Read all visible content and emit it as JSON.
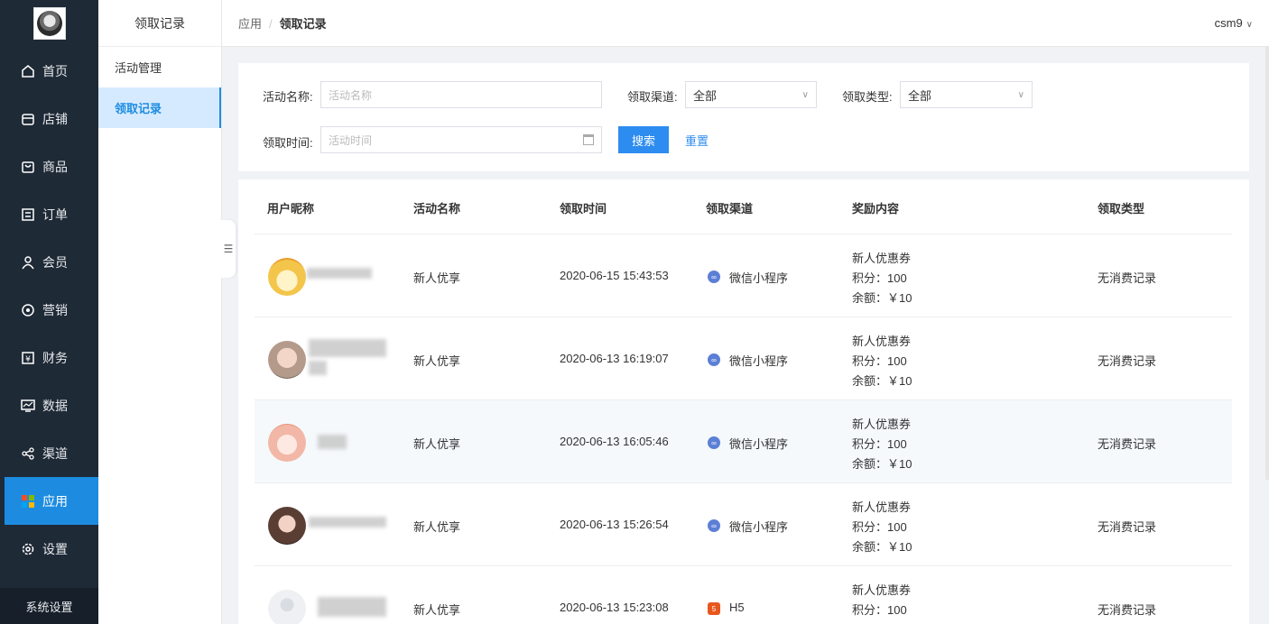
{
  "nav": {
    "items": [
      {
        "label": "首页",
        "icon": "home-icon"
      },
      {
        "label": "店铺",
        "icon": "store-icon"
      },
      {
        "label": "商品",
        "icon": "bag-icon"
      },
      {
        "label": "订单",
        "icon": "order-icon"
      },
      {
        "label": "会员",
        "icon": "user-icon"
      },
      {
        "label": "营销",
        "icon": "marketing-icon"
      },
      {
        "label": "财务",
        "icon": "finance-icon"
      },
      {
        "label": "数据",
        "icon": "chart-icon"
      },
      {
        "label": "渠道",
        "icon": "channel-icon"
      },
      {
        "label": "应用",
        "icon": "apps-icon"
      },
      {
        "label": "设置",
        "icon": "gear-icon"
      }
    ],
    "active_index": 9,
    "system_label": "系统设置"
  },
  "submenu": {
    "title": "领取记录",
    "items": [
      {
        "label": "活动管理"
      },
      {
        "label": "领取记录"
      }
    ]
  },
  "header": {
    "breadcrumb": [
      "应用",
      "领取记录"
    ],
    "user": "csm9"
  },
  "filter": {
    "activity_label": "活动名称:",
    "activity_placeholder": "活动名称",
    "channel_label": "领取渠道:",
    "channel_value": "全部",
    "type_label": "领取类型:",
    "type_value": "全部",
    "time_label": "领取时间:",
    "time_placeholder": "活动时间",
    "search_label": "搜索",
    "reset_label": "重置"
  },
  "table": {
    "columns": [
      "用户昵称",
      "活动名称",
      "领取时间",
      "领取渠道",
      "奖励内容",
      "领取类型"
    ],
    "rows": [
      {
        "activity": "新人优享",
        "time": "2020-06-15 15:43:53",
        "channel": "微信小程序",
        "channel_icon": "miniprogram-icon",
        "reward": [
          "新人优惠券",
          "积分：100",
          "余额：￥10"
        ],
        "type": "无消费记录"
      },
      {
        "activity": "新人优享",
        "time": "2020-06-13 16:19:07",
        "channel": "微信小程序",
        "channel_icon": "miniprogram-icon",
        "reward": [
          "新人优惠券",
          "积分：100",
          "余额：￥10"
        ],
        "type": "无消费记录"
      },
      {
        "activity": "新人优享",
        "time": "2020-06-13 16:05:46",
        "channel": "微信小程序",
        "channel_icon": "miniprogram-icon",
        "reward": [
          "新人优惠券",
          "积分：100",
          "余额：￥10"
        ],
        "type": "无消费记录"
      },
      {
        "activity": "新人优享",
        "time": "2020-06-13 15:26:54",
        "channel": "微信小程序",
        "channel_icon": "miniprogram-icon",
        "reward": [
          "新人优惠券",
          "积分：100",
          "余额：￥10"
        ],
        "type": "无消费记录"
      },
      {
        "activity": "新人优享",
        "time": "2020-06-13 15:23:08",
        "channel": "H5",
        "channel_icon": "h5-icon",
        "reward": [
          "新人优惠券",
          "积分：100"
        ],
        "type": "无消费记录"
      }
    ]
  }
}
